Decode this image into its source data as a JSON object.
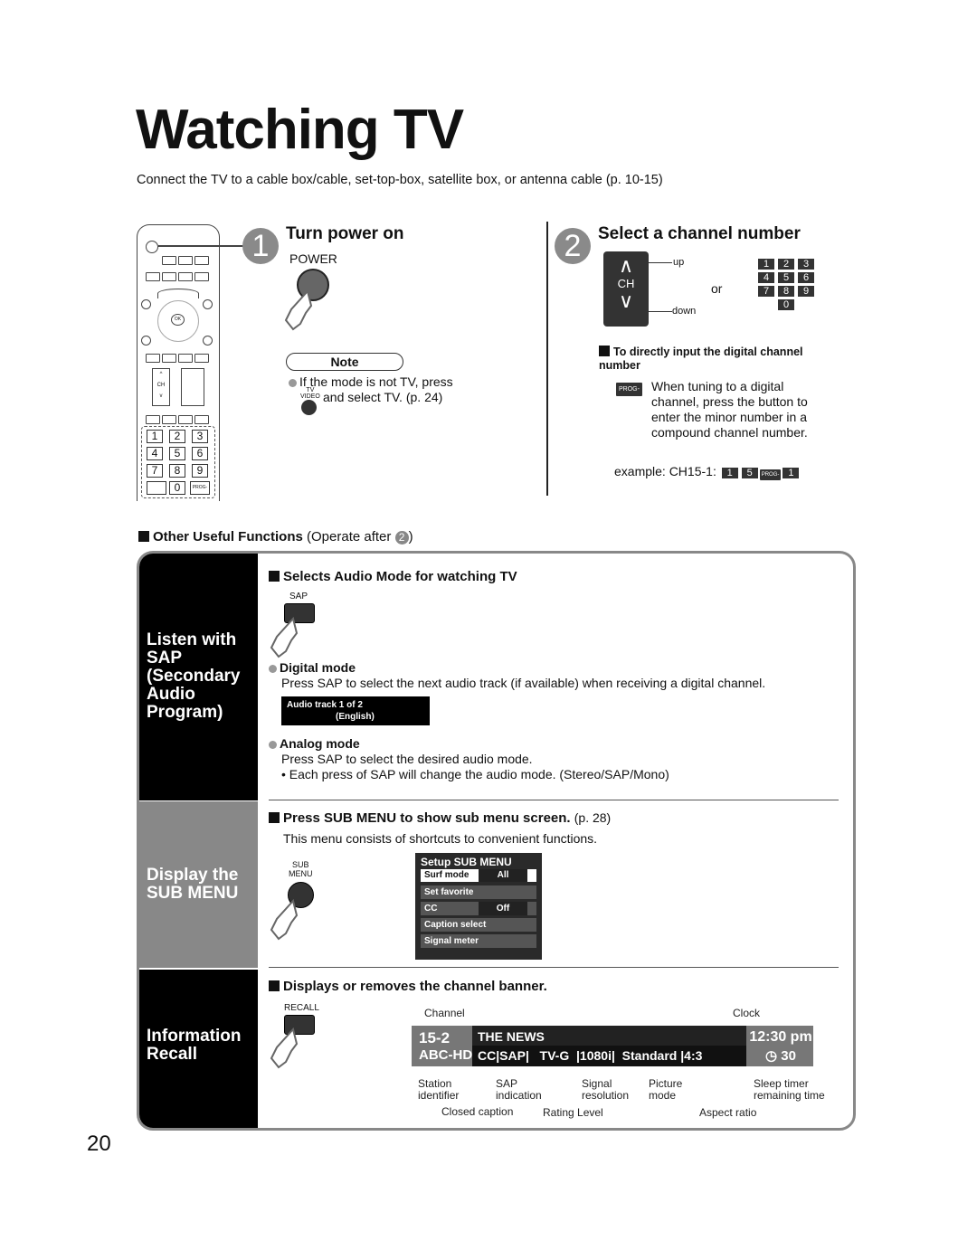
{
  "page": {
    "title": "Watching TV",
    "intro": "Connect the TV to a cable box/cable, set-top-box, satellite box, or antenna cable (p. 10-15)",
    "page_number": "20"
  },
  "remote": {
    "num_keys": [
      "1",
      "2",
      "3",
      "4",
      "5",
      "6",
      "7",
      "8",
      "9",
      "0"
    ],
    "ok_label": "OK",
    "ch_label": "CH",
    "prog_label": "PROG-"
  },
  "step1": {
    "number": "1",
    "title": "Turn power on",
    "button_label": "POWER",
    "note_label": "Note",
    "note_line1": "If the mode is not TV, press",
    "note_line2": "and select TV. (p. 24)",
    "tvvideo_label_top": "TV",
    "tvvideo_label_bottom": "VIDEO"
  },
  "step2": {
    "number": "2",
    "title": "Select a channel number",
    "ch_label": "CH",
    "up_label": "up",
    "down_label": "down",
    "or_label": "or",
    "keypad": [
      "1",
      "2",
      "3",
      "4",
      "5",
      "6",
      "7",
      "8",
      "9",
      "0"
    ],
    "direct_heading": "To directly input the digital channel number",
    "prog_label": "PROG-",
    "direct_text": "When tuning to a digital channel, press the button to enter the minor number in a compound channel number.",
    "example_label": "example:  CH15-1:",
    "example_keys": [
      "1",
      "5",
      "PROG-",
      "1"
    ]
  },
  "other": {
    "heading": "Other Useful Functions",
    "heading_suffix": "(Operate after",
    "heading_ref": "2",
    "heading_close": ")"
  },
  "sap_section": {
    "side_label": "Listen with SAP (Secondary Audio Program)",
    "heading": "Selects Audio Mode for watching TV",
    "button_label": "SAP",
    "digital_heading": "Digital mode",
    "digital_text": "Press SAP to select the next audio track (if available) when receiving a digital channel.",
    "osd_line1": "Audio track 1 of 2",
    "osd_line2": "(English)",
    "analog_heading": "Analog mode",
    "analog_text": "Press SAP to select the desired audio mode.",
    "analog_bullet": "• Each press of SAP will change the audio mode. (Stereo/SAP/Mono)"
  },
  "submenu_section": {
    "side_label": "Display the SUB MENU",
    "heading": "Press SUB MENU to show sub menu screen.",
    "heading_ref": "(p. 28)",
    "text": "This menu consists of shortcuts to convenient functions.",
    "button_label_top": "SUB",
    "button_label_bottom": "MENU",
    "menu_title": "Setup SUB MENU",
    "menu_items": [
      {
        "label": "Surf mode",
        "value": "All"
      },
      {
        "label": "Set favorite",
        "value": ""
      },
      {
        "label": "CC",
        "value": "Off"
      },
      {
        "label": "Caption select",
        "value": ""
      },
      {
        "label": "Signal meter",
        "value": ""
      }
    ]
  },
  "recall_section": {
    "side_label": "Information Recall",
    "heading": "Displays or removes the channel banner.",
    "button_label": "RECALL",
    "banner": {
      "channel": "15-2",
      "station": "ABC-HD",
      "program": "THE NEWS",
      "cc": "CC",
      "sap": "SAP",
      "rating": "TV-G",
      "resolution": "1080i",
      "picture_mode": "Standard",
      "aspect": "4:3",
      "clock": "12:30 pm",
      "sleep": "30"
    },
    "callouts": {
      "channel": "Channel",
      "clock": "Clock",
      "station": "Station identifier",
      "sap": "SAP indication",
      "signal": "Signal resolution",
      "picture": "Picture mode",
      "sleep": "Sleep timer remaining time",
      "cc": "Closed caption",
      "rating": "Rating Level",
      "aspect": "Aspect ratio"
    }
  }
}
